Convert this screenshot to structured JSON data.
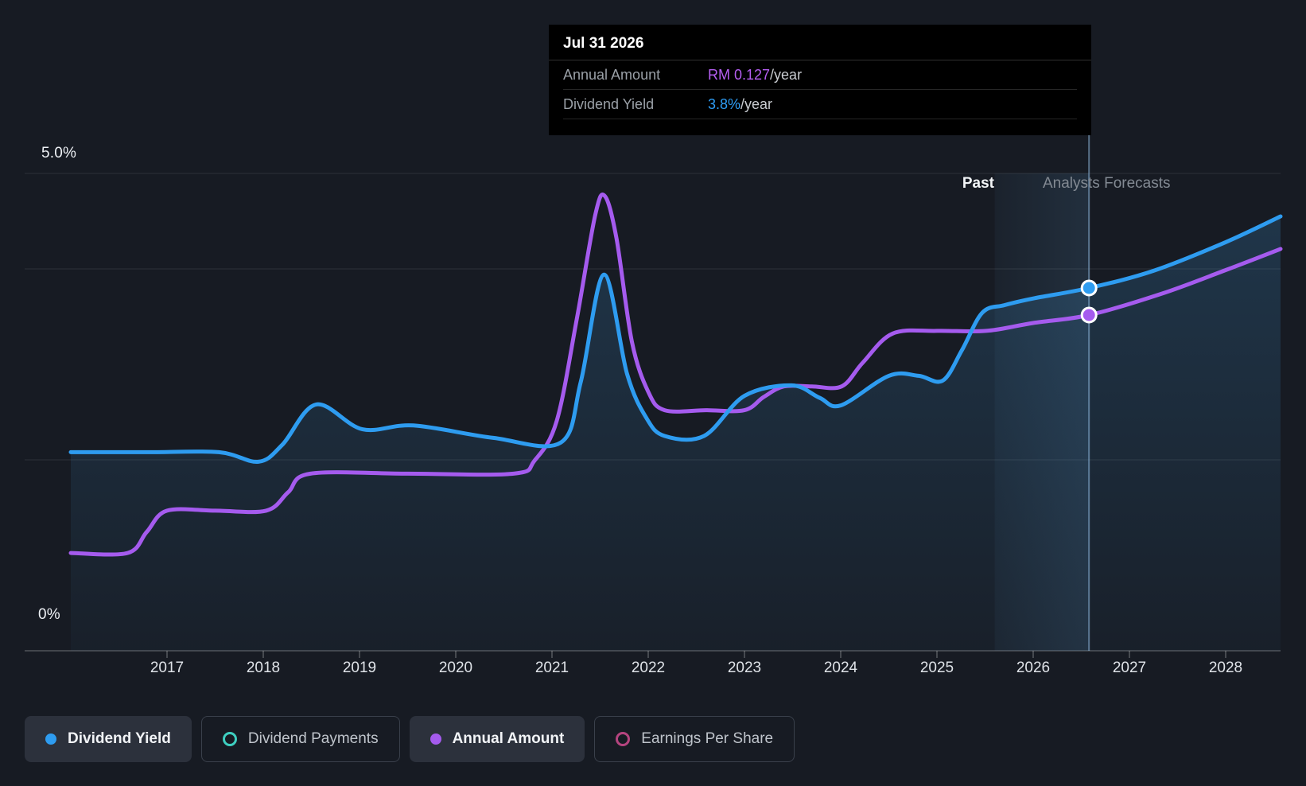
{
  "tooltip": {
    "date": "Jul 31 2026",
    "rows": [
      {
        "label": "Annual Amount",
        "value": "RM 0.127",
        "suffix": "/year",
        "color": "#b45ef0"
      },
      {
        "label": "Dividend Yield",
        "value": "3.8%",
        "suffix": "/year",
        "color": "#2e9df5"
      }
    ]
  },
  "axis": {
    "y_top_label": "5.0%",
    "y_bottom_label": "0%",
    "years": [
      "2017",
      "2018",
      "2019",
      "2020",
      "2021",
      "2022",
      "2023",
      "2024",
      "2025",
      "2026",
      "2027",
      "2028"
    ]
  },
  "annotations": {
    "past": "Past",
    "forecast": "Analysts Forecasts"
  },
  "legend": [
    {
      "label": "Dividend Yield",
      "color": "#2e9cf0",
      "style": "filled",
      "active": true
    },
    {
      "label": "Dividend Payments",
      "color": "#3ecfc0",
      "style": "ring",
      "active": false
    },
    {
      "label": "Annual Amount",
      "color": "#a55bee",
      "style": "filled",
      "active": true
    },
    {
      "label": "Earnings Per Share",
      "color": "#b5447f",
      "style": "ring",
      "active": false
    }
  ],
  "chart_data": {
    "type": "line",
    "title": "Dividend history and forecast",
    "x_range": [
      2016.0,
      2028.57
    ],
    "x_tick_years": [
      2017,
      2018,
      2019,
      2020,
      2021,
      2022,
      2023,
      2024,
      2025,
      2026,
      2027,
      2028
    ],
    "y_axis_percent": {
      "min": 0,
      "max": 5,
      "gridlines_pct": [
        5,
        4,
        2,
        0
      ],
      "labeled_ticks": {
        "5": "5.0%",
        "0": "0%"
      }
    },
    "forecast_band": {
      "start_x": 2025.6,
      "end_x": 2026.58
    },
    "hover_marker": {
      "date": "Jul 31 2026",
      "x": 2026.58,
      "dividend_yield_pct": 3.8,
      "annual_amount_rm": 0.127
    },
    "legend_position": "bottom",
    "grid": "horizontal-only",
    "series": [
      {
        "name": "Dividend Yield",
        "unit": "%",
        "color": "#2e9cf0",
        "area": true,
        "points": [
          [
            2016.0,
            2.08
          ],
          [
            2016.8,
            2.08
          ],
          [
            2017.54,
            2.08
          ],
          [
            2017.95,
            1.98
          ],
          [
            2018.2,
            2.16
          ],
          [
            2018.55,
            2.58
          ],
          [
            2019.03,
            2.32
          ],
          [
            2019.56,
            2.36
          ],
          [
            2020.39,
            2.23
          ],
          [
            2021.09,
            2.18
          ],
          [
            2021.3,
            2.82
          ],
          [
            2021.54,
            3.94
          ],
          [
            2021.78,
            2.9
          ],
          [
            2021.98,
            2.44
          ],
          [
            2022.17,
            2.25
          ],
          [
            2022.58,
            2.25
          ],
          [
            2023.0,
            2.67
          ],
          [
            2023.49,
            2.78
          ],
          [
            2023.78,
            2.65
          ],
          [
            2024.0,
            2.57
          ],
          [
            2024.5,
            2.88
          ],
          [
            2024.81,
            2.88
          ],
          [
            2025.06,
            2.83
          ],
          [
            2025.26,
            3.15
          ],
          [
            2025.47,
            3.54
          ],
          [
            2025.7,
            3.62
          ],
          [
            2026.0,
            3.69
          ],
          [
            2026.58,
            3.8
          ],
          [
            2027.25,
            3.98
          ],
          [
            2028.0,
            4.28
          ],
          [
            2028.57,
            4.55
          ]
        ]
      },
      {
        "name": "Annual Amount",
        "unit": "RM/year",
        "color": "#a55bee",
        "area": false,
        "points": [
          [
            2016.0,
            0.037
          ],
          [
            2016.59,
            0.037
          ],
          [
            2016.79,
            0.045
          ],
          [
            2017.0,
            0.053
          ],
          [
            2017.5,
            0.053
          ],
          [
            2018.03,
            0.053
          ],
          [
            2018.26,
            0.06
          ],
          [
            2018.49,
            0.067
          ],
          [
            2019.5,
            0.067
          ],
          [
            2020.6,
            0.067
          ],
          [
            2020.82,
            0.072
          ],
          [
            2021.05,
            0.087
          ],
          [
            2021.26,
            0.126
          ],
          [
            2021.45,
            0.165
          ],
          [
            2021.55,
            0.172
          ],
          [
            2021.67,
            0.156
          ],
          [
            2021.83,
            0.117
          ],
          [
            2022.0,
            0.098
          ],
          [
            2022.17,
            0.091
          ],
          [
            2022.6,
            0.091
          ],
          [
            2023.0,
            0.091
          ],
          [
            2023.2,
            0.096
          ],
          [
            2023.41,
            0.1
          ],
          [
            2023.7,
            0.1
          ],
          [
            2024.01,
            0.1
          ],
          [
            2024.23,
            0.109
          ],
          [
            2024.54,
            0.12
          ],
          [
            2025.0,
            0.121
          ],
          [
            2025.51,
            0.121
          ],
          [
            2026.0,
            0.124
          ],
          [
            2026.58,
            0.127
          ],
          [
            2027.33,
            0.135
          ],
          [
            2028.0,
            0.144
          ],
          [
            2028.57,
            0.152
          ]
        ]
      }
    ]
  }
}
